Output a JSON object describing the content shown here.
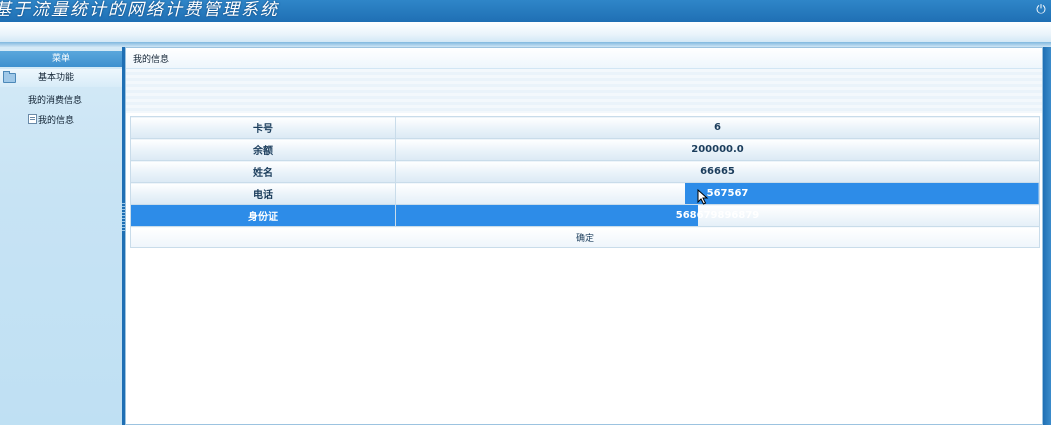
{
  "app": {
    "title": "基于流量统计的网络计费管理系统",
    "power_icon": "power-icon"
  },
  "sidebar": {
    "header": "菜单",
    "group": {
      "label": "基本功能",
      "icon": "folder-icon"
    },
    "items": [
      {
        "label": "我的消费信息",
        "icon": ""
      },
      {
        "label": "我的信息",
        "icon": "document-icon"
      }
    ]
  },
  "main": {
    "title": "我的信息",
    "rows": [
      {
        "label": "卡号",
        "value": "6"
      },
      {
        "label": "余额",
        "value": "200000.0"
      },
      {
        "label": "姓名",
        "value": "66665"
      },
      {
        "label": "电话",
        "value": "567567"
      },
      {
        "label": "身份证",
        "value": "568679896879"
      }
    ],
    "confirm_label": "确定"
  },
  "colors": {
    "header": "#1f6fb4",
    "selection": "#2d8ce8",
    "sidebar": "#c7e3f4"
  }
}
